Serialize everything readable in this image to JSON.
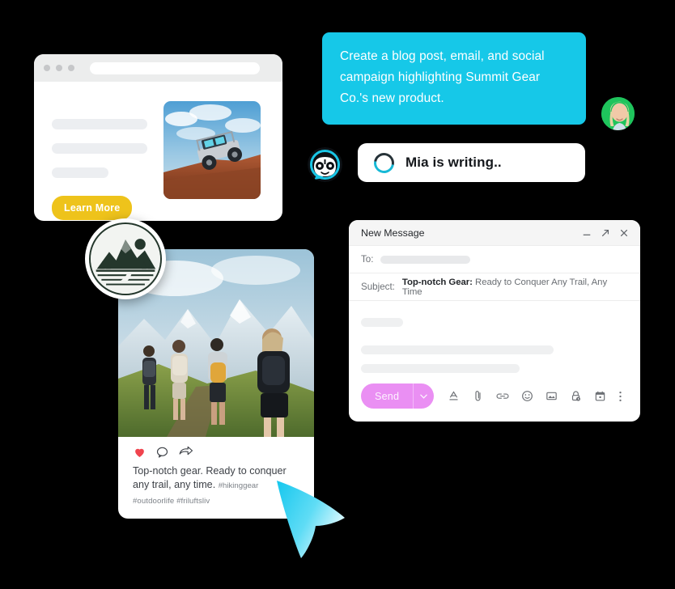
{
  "browser": {
    "name": "landing-page-preview",
    "dots": [
      "dot-red",
      "dot-yellow",
      "dot-green"
    ],
    "address_value": "",
    "cta_label": "Learn More",
    "photo_alt": "off-road jeep climbing red rock"
  },
  "brand": {
    "name": "Summit Gear Co.",
    "logo_alt": "mountain and lake circular emblem"
  },
  "social": {
    "photo_alt": "group of hikers with backpacks on mountain trail",
    "actions": [
      "heart-icon",
      "comment-icon",
      "share-icon"
    ],
    "caption_line1": "Top-notch gear. Ready to conquer",
    "caption_line2": "any trail, any time.",
    "caption_tag_inline": "#hikinggear",
    "caption_tags": "#outdoorlife #friluftsliv"
  },
  "chat": {
    "user_message": "Create a blog post, email, and social campaign highlighting Summit Gear Co.'s new product.",
    "bubble_color": "#16c8e8",
    "user_avatar_alt": "smiling woman profile photo",
    "bot_avatar_alt": "cyan robot assistant avatar",
    "status_text": "Mia is writing..",
    "spinner_color": "#17b9d6"
  },
  "email": {
    "title": "New Message",
    "window_controls": [
      "minimize-icon",
      "expand-icon",
      "close-icon"
    ],
    "to_label": "To:",
    "to_value": "",
    "subject_label": "Subject:",
    "subject_bold": "Top-notch Gear:",
    "subject_rest": " Ready to Conquer Any Trail, Any Time",
    "body_value": "",
    "send_label": "Send",
    "send_color": "#ea8ff3",
    "toolbar_icons": [
      "format-text-icon",
      "attach-file-icon",
      "insert-link-icon",
      "insert-emoji-icon",
      "insert-photo-icon",
      "confidential-mode-icon",
      "schedule-send-icon",
      "more-options-icon"
    ]
  },
  "cursor": {
    "name": "pointer-cursor",
    "color": "#19d6f5"
  }
}
